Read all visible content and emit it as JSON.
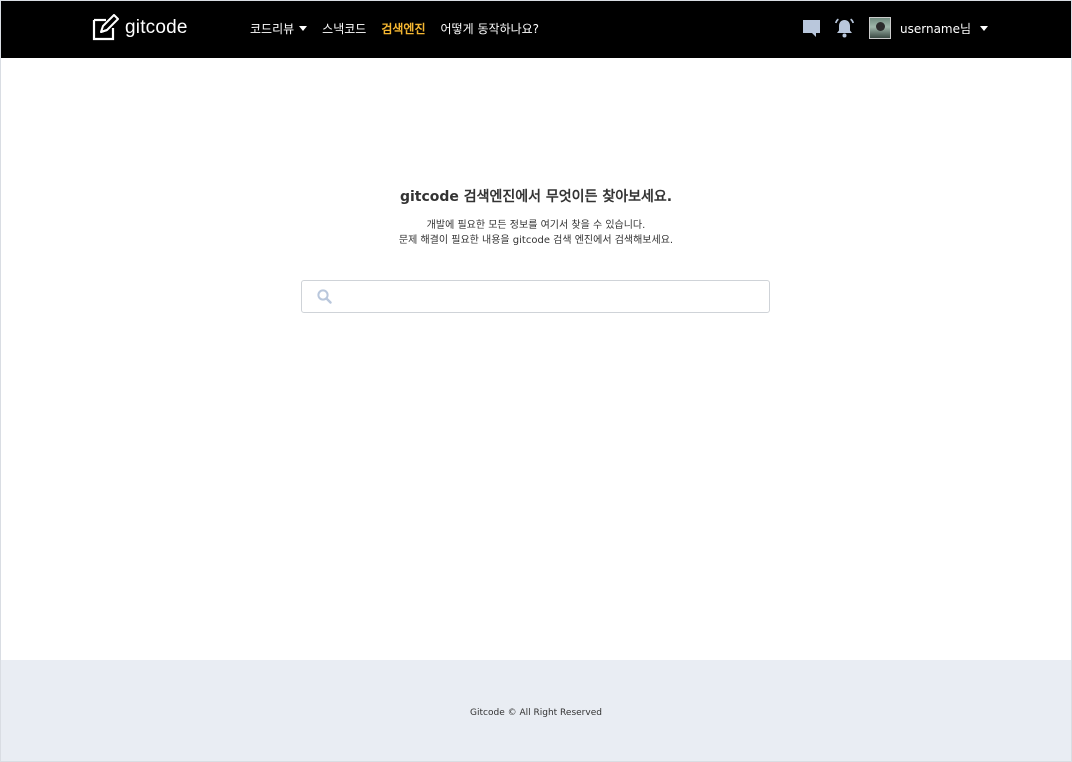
{
  "brand": {
    "name": "gitcode"
  },
  "nav": {
    "items": [
      {
        "label": "코드리뷰",
        "dropdown": true,
        "active": false
      },
      {
        "label": "스낵코드",
        "dropdown": false,
        "active": false
      },
      {
        "label": "검색엔진",
        "dropdown": false,
        "active": true
      },
      {
        "label": "어떻게 동작하나요?",
        "dropdown": false,
        "active": false
      }
    ],
    "active_color": "#f5b731"
  },
  "user": {
    "name": "username님"
  },
  "icons": {
    "brand": "edit-square-icon",
    "messages": "chat-bubble-icon",
    "notifications": "bell-ring-icon",
    "search": "search-icon"
  },
  "hero": {
    "title": "gitcode 검색엔진에서 무엇이든 찾아보세요.",
    "desc_line1": "개발에 필요한 모든 정보를 여기서 찾을 수 있습니다.",
    "desc_line2": "문제 해결이 필요한 내용을 gitcode 검색 엔진에서 검색해보세요."
  },
  "search": {
    "value": "",
    "placeholder": ""
  },
  "footer": {
    "text": "Gitcode © All Right Reserved"
  }
}
